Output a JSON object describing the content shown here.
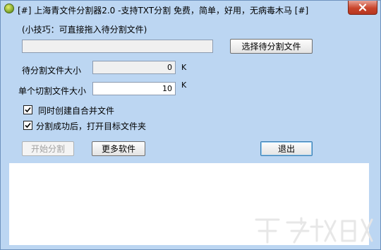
{
  "window": {
    "title": "[#] 上海青文件分割器2.0 -支持TXT分割 免费，简单，好用，无病毒木马 [#]"
  },
  "tip": {
    "text": "(小技巧：可直接拖入待分割文件)"
  },
  "file_path": {
    "value": ""
  },
  "buttons": {
    "select_file": "选择待分割文件",
    "start_split": "开始分割",
    "more_software": "更多软件",
    "exit": "退出"
  },
  "file_size": {
    "label": "待分割文件大小",
    "value": "0",
    "unit": "K"
  },
  "chunk_size": {
    "label": "单个切割文件大小",
    "value": "10",
    "unit": "K"
  },
  "options": {
    "create_merge": {
      "label": "同时创建自合并文件",
      "checked": true
    },
    "open_folder": {
      "label": "分割成功后，打开目标文件夹",
      "checked": true
    }
  },
  "log": {
    "text": ""
  },
  "icons": [
    "app-icon",
    "close-icon",
    "checkmark-icon"
  ]
}
